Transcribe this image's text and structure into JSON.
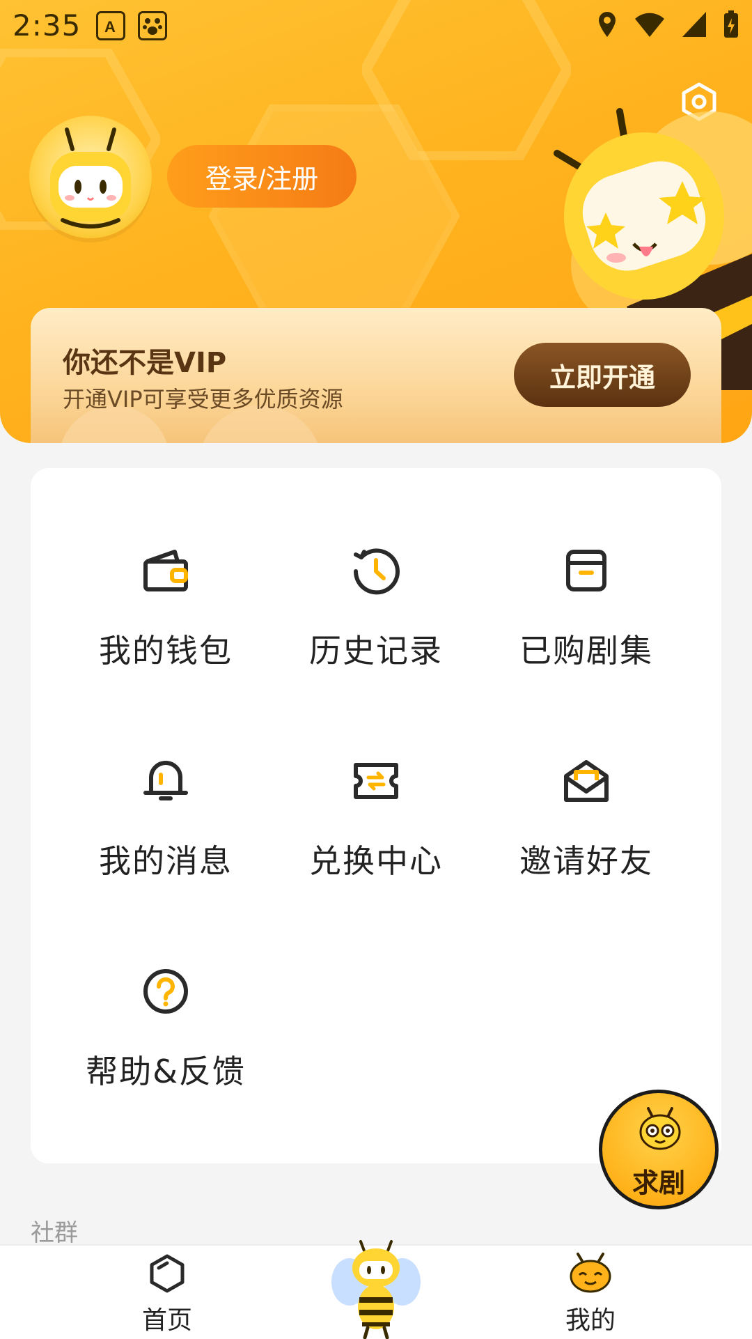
{
  "status_bar": {
    "time": "2:35"
  },
  "header": {
    "login_button": "登录/注册",
    "settings_icon": "hexagon-settings-icon"
  },
  "vip": {
    "title": "你还不是VIP",
    "subtitle": "开通VIP可享受更多优质资源",
    "button": "立即开通"
  },
  "menu": {
    "items": [
      {
        "label": "我的钱包",
        "icon": "wallet-icon"
      },
      {
        "label": "历史记录",
        "icon": "history-icon"
      },
      {
        "label": "已购剧集",
        "icon": "purchased-box-icon"
      },
      {
        "label": "我的消息",
        "icon": "bell-icon"
      },
      {
        "label": "兑换中心",
        "icon": "exchange-ticket-icon"
      },
      {
        "label": "邀请好友",
        "icon": "invite-envelope-icon"
      },
      {
        "label": "帮助&反馈",
        "icon": "help-question-icon"
      }
    ]
  },
  "fab": {
    "label": "求剧"
  },
  "section": {
    "title": "社群"
  },
  "nav": {
    "items": [
      {
        "label": "首页",
        "icon": "home-hexagon-icon"
      },
      {
        "label": "",
        "icon": "bee-mascot-icon"
      },
      {
        "label": "我的",
        "icon": "bee-face-icon"
      }
    ]
  },
  "colors": {
    "brand_yellow": "#ffb31f",
    "login_orange": "#f57b15",
    "vip_brown": "#5b3210",
    "accent_icon": "#ffb400"
  }
}
